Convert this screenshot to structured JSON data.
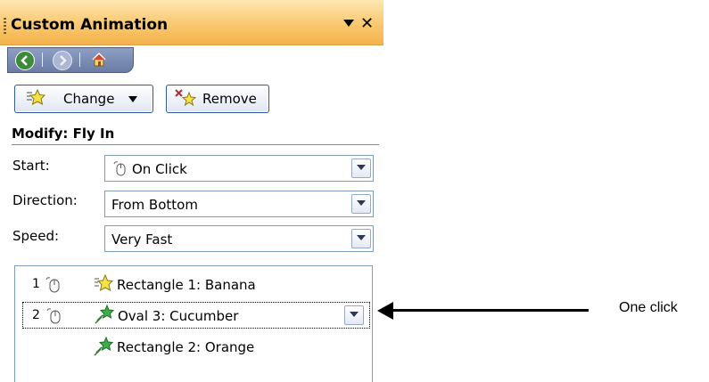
{
  "pane": {
    "title": "Custom Animation",
    "icons": {
      "dropdown": "dropdown-triangle-icon",
      "close": "close-x-icon"
    }
  },
  "nav": {
    "back_icon": "back-arrow-icon",
    "forward_icon": "forward-arrow-icon",
    "home_icon": "home-icon"
  },
  "toolbar": {
    "change_label": "Change",
    "remove_label": "Remove"
  },
  "modify": {
    "title": "Modify: Fly In",
    "start_label": "Start:",
    "start_value": "On Click",
    "direction_label": "Direction:",
    "direction_value": "From Bottom",
    "speed_label": "Speed:",
    "speed_value": "Very Fast"
  },
  "animation_list": [
    {
      "number": "1",
      "name": "Rectangle 1: Banana",
      "effect_icon": "entrance-star-icon",
      "trigger_icon": "mouse-click-icon"
    },
    {
      "number": "2",
      "name": "Oval 3: Cucumber",
      "effect_icon": "motion-star-icon",
      "trigger_icon": "mouse-click-icon",
      "selected": true
    },
    {
      "number": "",
      "name": "Rectangle 2: Orange",
      "effect_icon": "motion-star-icon"
    }
  ],
  "annotation": {
    "label": "One click"
  },
  "colors": {
    "titlebar": "#f9c56a",
    "nav_strip": "#7b8db3",
    "button_border": "#2f56a8"
  }
}
